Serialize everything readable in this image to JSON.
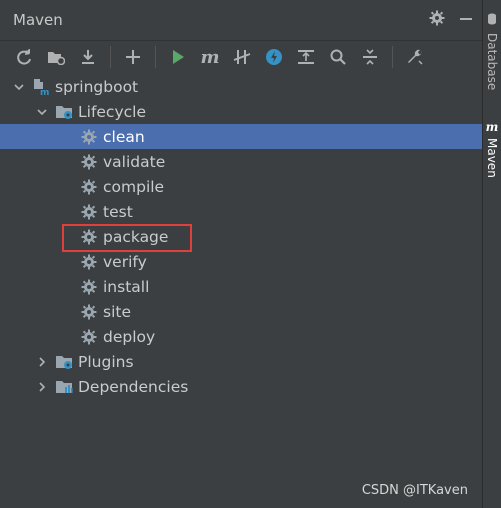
{
  "panel": {
    "title": "Maven"
  },
  "side_tabs": {
    "database": "Database",
    "maven": "Maven"
  },
  "tree": {
    "project": "springboot",
    "lifecycle": "Lifecycle",
    "goals": [
      "clean",
      "validate",
      "compile",
      "test",
      "package",
      "verify",
      "install",
      "site",
      "deploy"
    ],
    "plugins": "Plugins",
    "dependencies": "Dependencies"
  },
  "watermark": "CSDN @ITKaven",
  "colors": {
    "background": "#3c3f41",
    "selection": "#4b6eaf",
    "highlight": "#e0403b",
    "run_green": "#59a869",
    "accent_blue": "#3592c4"
  }
}
